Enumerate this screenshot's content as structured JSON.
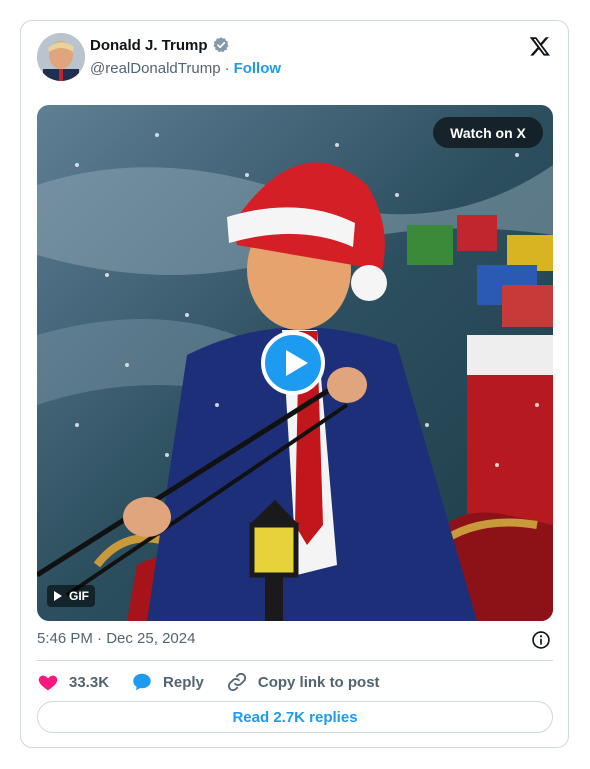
{
  "author": {
    "name": "Donald J. Trump",
    "handle": "@realDonaldTrump",
    "separator": "·",
    "follow_label": "Follow",
    "verified_icon": "verified-badge-icon"
  },
  "media": {
    "watch_label": "Watch on X",
    "gif_label": "GIF",
    "play_icon": "play-icon"
  },
  "meta": {
    "time": "5:46 PM",
    "separator": "·",
    "date": "Dec 25, 2024"
  },
  "actions": {
    "likes": "33.3K",
    "reply_label": "Reply",
    "copy_label": "Copy link to post"
  },
  "footer": {
    "read_replies_label": "Read 2.7K replies"
  },
  "colors": {
    "accent": "#1d9bf0",
    "like": "#f91880",
    "text": "#0f1419",
    "muted": "#536471",
    "border": "#cfd9de"
  }
}
